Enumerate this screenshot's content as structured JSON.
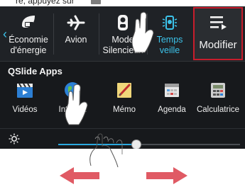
{
  "top_strip": {
    "text": "ré, appuyez sur"
  },
  "toggles": [
    {
      "label": "Économie\nd'énergie",
      "icon": "battery-saver-icon",
      "active": false
    },
    {
      "label": "Avion",
      "icon": "airplane-icon",
      "active": false
    },
    {
      "label": "Mode\nSilencieux",
      "icon": "silent-mode-icon",
      "active": false
    },
    {
      "label": "Temps\nveille",
      "icon": "screen-timeout-icon",
      "active": true
    }
  ],
  "modify_button": {
    "label": "Modifier",
    "icon": "edit-list-icon"
  },
  "qslide": {
    "title": "QSlide Apps",
    "apps": [
      {
        "label": "Vidéos",
        "icon": "video-clapper-icon"
      },
      {
        "label": "Internet",
        "icon": "globe-icon"
      },
      {
        "label": "Mémo",
        "icon": "memo-pencil-icon"
      },
      {
        "label": "Agenda",
        "icon": "calendar-icon"
      },
      {
        "label": "Calculatrice",
        "icon": "calculator-icon"
      }
    ]
  },
  "brightness": {
    "icon": "brightness-sun-icon",
    "level": 0.43
  },
  "colors": {
    "accent": "#3cc3ea",
    "highlight": "#c81d2c",
    "panel": "#17191c",
    "arrow": "#e05a64"
  },
  "gestures": [
    "tap-hand-icon",
    "tap-hand-icon",
    "swipe-hand-icon",
    "swipe-arrows-icon"
  ]
}
